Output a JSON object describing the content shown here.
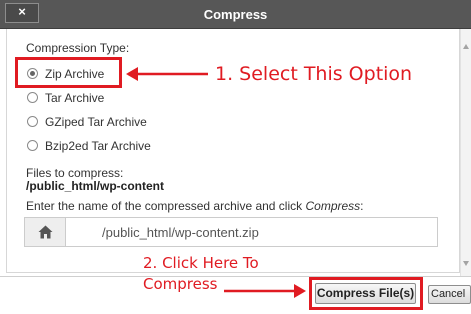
{
  "dialog": {
    "title": "Compress",
    "close_label": "×"
  },
  "compression": {
    "heading": "Compression Type:",
    "options": [
      {
        "label": "Zip Archive",
        "selected": true
      },
      {
        "label": "Tar Archive",
        "selected": false
      },
      {
        "label": "GZiped Tar Archive",
        "selected": false
      },
      {
        "label": "Bzip2ed Tar Archive",
        "selected": false
      }
    ]
  },
  "files": {
    "heading": "Files to compress:",
    "path": "/public_html/wp-content"
  },
  "archive_name": {
    "prompt_prefix": "Enter the name of the compressed archive and click ",
    "prompt_emphasis": "Compress",
    "prompt_suffix": ":",
    "value": "/public_html/wp-content.zip",
    "icon": "home-icon"
  },
  "buttons": {
    "compress": "Compress File(s)",
    "cancel": "Cancel"
  },
  "annotations": {
    "step1": "1. Select This Option",
    "step2_line1": "2. Click Here To",
    "step2_line2": "Compress"
  },
  "colors": {
    "title_bar": "#575757",
    "annotation_red": "#e01b22"
  }
}
